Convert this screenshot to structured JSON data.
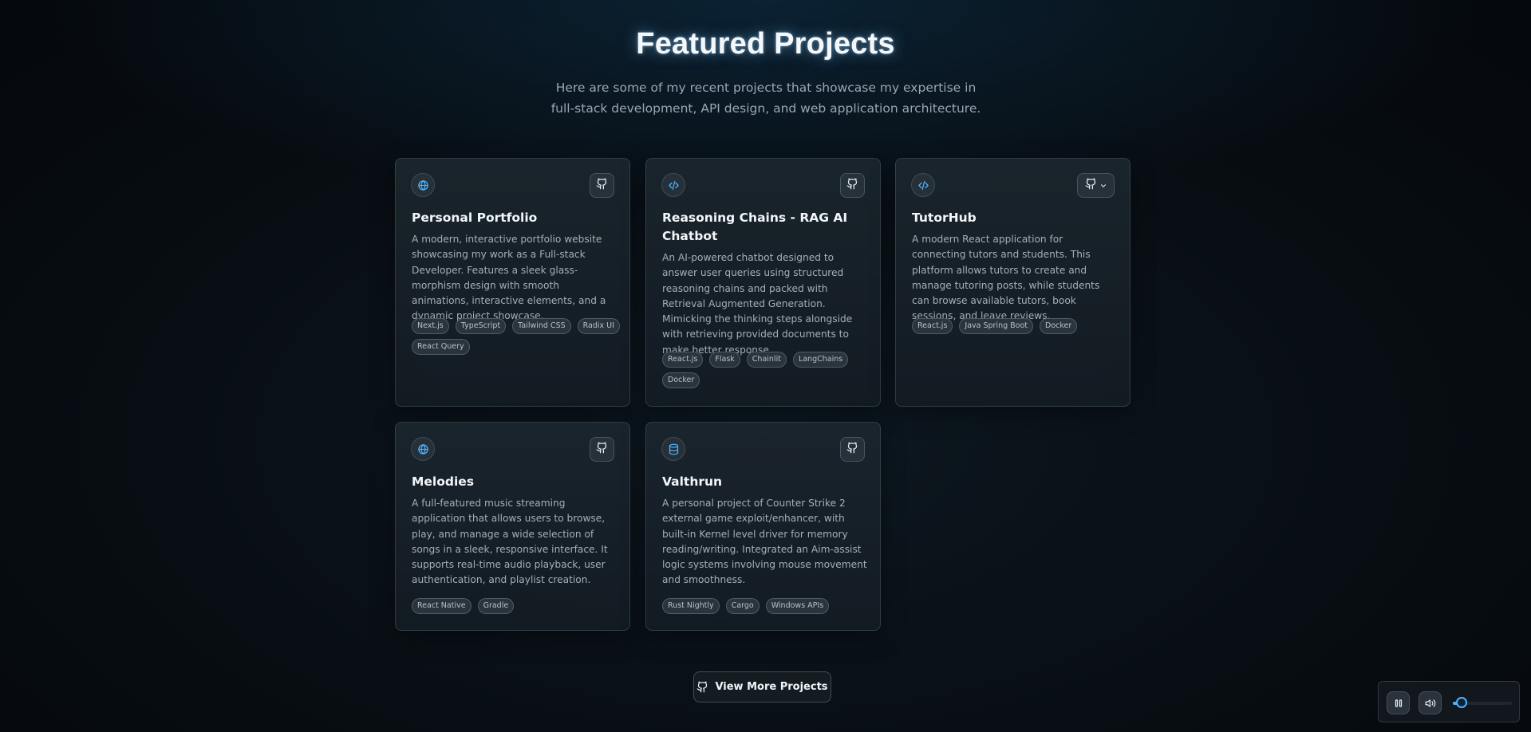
{
  "header": {
    "title": "Featured Projects",
    "subtitle": "Here are some of my recent projects that showcase my expertise in full-stack development, API design, and web application architecture."
  },
  "projects": [
    {
      "icon": "globe-icon",
      "title": "Personal Portfolio",
      "description": "A modern, interactive portfolio website showcasing my work as a Full-stack Developer. Features a sleek glass-morphism design with smooth animations, interactive elements, and a dynamic project showcase.",
      "tags": [
        "Next.js",
        "TypeScript",
        "Tailwind CSS",
        "Radix UI",
        "React Query"
      ]
    },
    {
      "icon": "code-icon",
      "title": "Reasoning Chains - RAG AI Chatbot",
      "description": "An AI-powered chatbot designed to answer user queries using structured reasoning chains and packed with Retrieval Augmented Generation. Mimicking the thinking steps alongside with retrieving provided documents to make better response.",
      "tags": [
        "React.js",
        "Flask",
        "Chainlit",
        "LangChains",
        "Docker"
      ]
    },
    {
      "icon": "code-icon",
      "title": "TutorHub",
      "description": "A modern React application for connecting tutors and students. This platform allows tutors to create and manage tutoring posts, while students can browse available tutors, book sessions, and leave reviews.",
      "tags": [
        "React.js",
        "Java Spring Boot",
        "Docker"
      ]
    },
    {
      "icon": "globe-icon",
      "title": "Melodies",
      "description": "A full-featured music streaming application that allows users to browse, play, and manage a wide selection of songs in a sleek, responsive interface. It supports real-time audio playback, user authentication, and playlist creation.",
      "tags": [
        "React Native",
        "Gradle"
      ]
    },
    {
      "icon": "database-icon",
      "title": "Valthrun",
      "description": "A personal project of Counter Strike 2 external game exploit/enhancer, with built-in Kernel level driver for memory reading/writing. Integrated an Aim-assist logic systems involving mouse movement and smoothness.",
      "tags": [
        "Rust Nightly",
        "Cargo",
        "Windows APIs"
      ]
    }
  ],
  "view_more": {
    "label": "View More Projects"
  },
  "player": {
    "volume_percent": 15
  },
  "colors": {
    "accent": "#4db3ff",
    "background": "#070c11",
    "card": "#1a242c"
  }
}
